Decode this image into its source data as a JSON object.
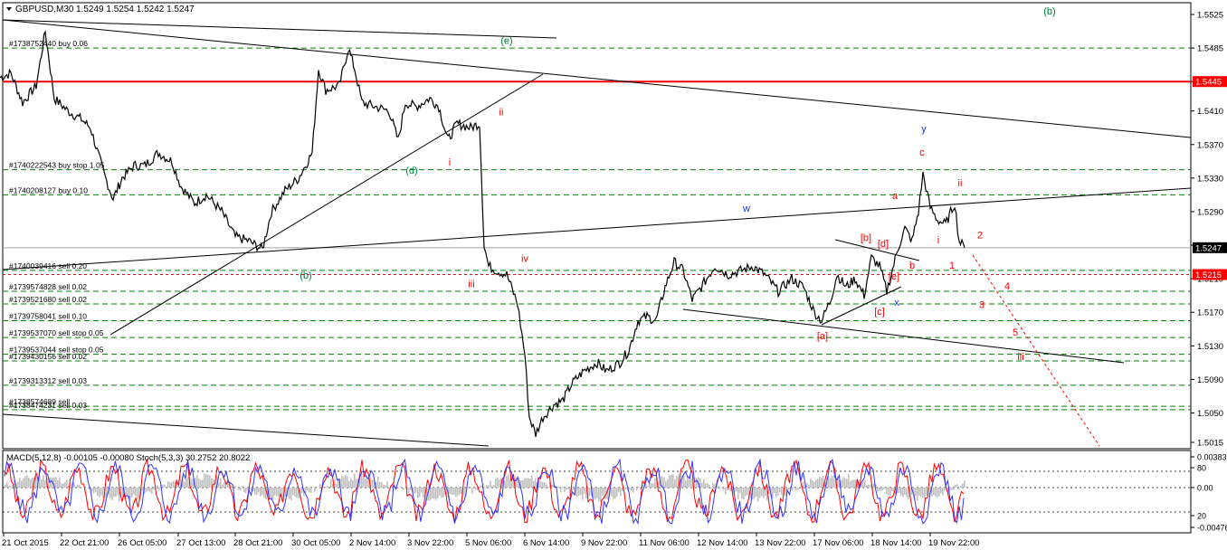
{
  "header": {
    "symbol": "GBPUSD,M30",
    "quote": "1.5249 1.5254 1.5242 1.5247"
  },
  "colors": {
    "price_line": "#000000",
    "resistance": "#ff0000",
    "order_line": "#008000",
    "current_price_bg": "#000000",
    "macd_hist": "#c0c0c0",
    "stoch_main": "#3333ff",
    "stoch_signal": "#ff0000",
    "wave_red": "#ff0000",
    "wave_green": "#008040",
    "wave_blue": "#1a33cc"
  },
  "chart_data": [
    {
      "type": "line",
      "title": "GBPUSD,M30",
      "yaxis_ticks": [
        1.5525,
        1.5485,
        1.5445,
        1.541,
        1.537,
        1.533,
        1.529,
        1.525,
        1.521,
        1.517,
        1.513,
        1.509,
        1.505,
        1.5015
      ],
      "ylim": [
        1.5005,
        1.5535
      ],
      "xaxis_ticks": [
        "21 Oct 2015",
        "22 Oct 21:00",
        "26 Oct 05:00",
        "27 Oct 13:00",
        "28 Oct 21:00",
        "30 Oct 05:00",
        "2 Nov 14:00",
        "3 Nov 22:00",
        "5 Nov 06:00",
        "6 Nov 14:00",
        "9 Nov 22:00",
        "11 Nov 06:00",
        "12 Nov 14:00",
        "13 Nov 22:00",
        "17 Nov 06:00",
        "18 Nov 14:00",
        "19 Nov 22:00"
      ],
      "current_price": "1.5247",
      "price_labels": [
        {
          "text": "1.5445",
          "value": 1.5445,
          "style": "red"
        },
        {
          "text": "1.5247",
          "value": 1.5247,
          "style": "black"
        },
        {
          "text": "1.5215",
          "value": 1.5215,
          "style": "red"
        }
      ],
      "series": [
        {
          "key": "GBPUSD",
          "values": [
            [
              0,
              1.545
            ],
            [
              12,
              1.5455
            ],
            [
              25,
              1.542
            ],
            [
              40,
              1.544
            ],
            [
              50,
              1.5505
            ],
            [
              60,
              1.5425
            ],
            [
              75,
              1.541
            ],
            [
              90,
              1.54
            ],
            [
              100,
              1.539
            ],
            [
              115,
              1.5335
            ],
            [
              125,
              1.5305
            ],
            [
              135,
              1.533
            ],
            [
              148,
              1.5345
            ],
            [
              160,
              1.5345
            ],
            [
              175,
              1.536
            ],
            [
              190,
              1.535
            ],
            [
              200,
              1.532
            ],
            [
              215,
              1.53
            ],
            [
              228,
              1.531
            ],
            [
              245,
              1.529
            ],
            [
              260,
              1.526
            ],
            [
              275,
              1.5255
            ],
            [
              290,
              1.5245
            ],
            [
              300,
              1.529
            ],
            [
              315,
              1.5315
            ],
            [
              330,
              1.533
            ],
            [
              345,
              1.536
            ],
            [
              352,
              1.546
            ],
            [
              360,
              1.5435
            ],
            [
              375,
              1.544
            ],
            [
              385,
              1.5485
            ],
            [
              392,
              1.546
            ],
            [
              400,
              1.542
            ],
            [
              415,
              1.5415
            ],
            [
              430,
              1.541
            ],
            [
              440,
              1.5375
            ],
            [
              448,
              1.542
            ],
            [
              460,
              1.5415
            ],
            [
              475,
              1.5425
            ],
            [
              485,
              1.5415
            ],
            [
              495,
              1.5375
            ],
            [
              505,
              1.5395
            ],
            [
              520,
              1.539
            ],
            [
              530,
              1.5395
            ],
            [
              535,
              1.525
            ],
            [
              540,
              1.5225
            ],
            [
              548,
              1.522
            ],
            [
              560,
              1.5215
            ],
            [
              572,
              1.518
            ],
            [
              580,
              1.512
            ],
            [
              585,
              1.5045
            ],
            [
              592,
              1.5025
            ],
            [
              600,
              1.5045
            ],
            [
              612,
              1.506
            ],
            [
              622,
              1.5065
            ],
            [
              632,
              1.5085
            ],
            [
              645,
              1.51
            ],
            [
              660,
              1.511
            ],
            [
              670,
              1.51
            ],
            [
              685,
              1.511
            ],
            [
              695,
              1.5125
            ],
            [
              705,
              1.516
            ],
            [
              715,
              1.5165
            ],
            [
              725,
              1.516
            ],
            [
              735,
              1.52
            ],
            [
              745,
              1.523
            ],
            [
              755,
              1.522
            ],
            [
              765,
              1.5185
            ],
            [
              775,
              1.52
            ],
            [
              790,
              1.5225
            ],
            [
              805,
              1.5215
            ],
            [
              820,
              1.522
            ],
            [
              832,
              1.5225
            ],
            [
              845,
              1.5215
            ],
            [
              860,
              1.5195
            ],
            [
              875,
              1.521
            ],
            [
              888,
              1.52
            ],
            [
              900,
              1.517
            ],
            [
              908,
              1.516
            ],
            [
              918,
              1.5185
            ],
            [
              925,
              1.5215
            ],
            [
              935,
              1.52
            ],
            [
              945,
              1.521
            ],
            [
              955,
              1.519
            ],
            [
              963,
              1.5235
            ],
            [
              972,
              1.5225
            ],
            [
              980,
              1.5195
            ],
            [
              985,
              1.5215
            ],
            [
              992,
              1.5245
            ],
            [
              1000,
              1.527
            ],
            [
              1008,
              1.5255
            ],
            [
              1015,
              1.529
            ],
            [
              1020,
              1.5335
            ],
            [
              1028,
              1.5295
            ],
            [
              1036,
              1.528
            ],
            [
              1045,
              1.5275
            ],
            [
              1055,
              1.53
            ],
            [
              1060,
              1.5255
            ],
            [
              1066,
              1.5247
            ]
          ]
        }
      ],
      "horizontal_lines": [
        {
          "value": 1.5445,
          "style": "solid",
          "color": "red"
        },
        {
          "value": 1.5215,
          "style": "dashed",
          "color": "red"
        }
      ],
      "order_lines": [
        {
          "text": "#1738752440 buy 0.06",
          "value": 1.5485
        },
        {
          "text": "#1740222543 buy stop 1.05",
          "value": 1.534
        },
        {
          "text": "#1740208127 buy 0.10",
          "value": 1.531
        },
        {
          "text": "#1740039416 sell 0.20",
          "value": 1.522
        },
        {
          "text": "#1739574828 sell 0.02",
          "value": 1.5195
        },
        {
          "text": "#1739521680 sell 0.02",
          "value": 1.518
        },
        {
          "text": "#1739758041 sell 0.10",
          "value": 1.516
        },
        {
          "text": "#1739537070 sell stop 0.05",
          "value": 1.514
        },
        {
          "text": "#1739537044 sell stop 0.05",
          "value": 1.512
        },
        {
          "text": "#1739430156 sell 0.02",
          "value": 1.5112
        },
        {
          "text": "#1739313312 sell 0.03",
          "value": 1.5083
        },
        {
          "text": "#1738574689 sell",
          "value": 1.5058
        },
        {
          "text": "#1738474231 sell 0.03",
          "value": 1.5054
        }
      ],
      "annotations": [
        {
          "text": "(b)",
          "x": 1160,
          "y": 1.5525,
          "color": "green"
        },
        {
          "text": "(e)",
          "x": 560,
          "y": 1.549,
          "color": "green"
        },
        {
          "text": "ii",
          "x": 554,
          "y": 1.5405,
          "color": "red"
        },
        {
          "text": "i",
          "x": 497,
          "y": 1.5345,
          "color": "red"
        },
        {
          "text": "(d)",
          "x": 455,
          "y": 1.5335,
          "color": "green"
        },
        {
          "text": "(b)",
          "x": 338,
          "y": 1.521,
          "color": "green"
        },
        {
          "text": "iii",
          "x": 521,
          "y": 1.52,
          "color": "red"
        },
        {
          "text": "iv",
          "x": 580,
          "y": 1.523,
          "color": "red"
        },
        {
          "text": "w",
          "x": 825,
          "y": 1.529,
          "color": "blue"
        },
        {
          "text": "y",
          "x": 1021,
          "y": 1.5385,
          "color": "blue"
        },
        {
          "text": "c",
          "x": 1019,
          "y": 1.5357,
          "color": "red"
        },
        {
          "text": "ii",
          "x": 1061,
          "y": 1.532,
          "color": "red"
        },
        {
          "text": "a",
          "x": 989,
          "y": 1.5305,
          "color": "red"
        },
        {
          "text": "[b]",
          "x": 957,
          "y": 1.5255,
          "color": "red"
        },
        {
          "text": "[d]",
          "x": 976,
          "y": 1.5248,
          "color": "red"
        },
        {
          "text": "i",
          "x": 1037,
          "y": 1.5252,
          "color": "red"
        },
        {
          "text": "2",
          "x": 1083,
          "y": 1.5258,
          "color": "red"
        },
        {
          "text": "b",
          "x": 1008,
          "y": 1.5222,
          "color": "red"
        },
        {
          "text": "1",
          "x": 1052,
          "y": 1.5222,
          "color": "red"
        },
        {
          "text": "[e]",
          "x": 988,
          "y": 1.5209,
          "color": "red"
        },
        {
          "text": "4",
          "x": 1113,
          "y": 1.5197,
          "color": "red"
        },
        {
          "text": "x",
          "x": 991,
          "y": 1.5178,
          "color": "blue"
        },
        {
          "text": "[c]",
          "x": 972,
          "y": 1.5167,
          "color": "red"
        },
        {
          "text": "3",
          "x": 1085,
          "y": 1.5175,
          "color": "red"
        },
        {
          "text": "[a]",
          "x": 909,
          "y": 1.5138,
          "color": "red"
        },
        {
          "text": "5",
          "x": 1122,
          "y": 1.5142,
          "color": "red"
        },
        {
          "text": "iii",
          "x": 1128,
          "y": 1.5113,
          "color": "red"
        }
      ]
    },
    {
      "type": "line",
      "title": "MACD(5,12,8) -0.00105 -0.00080 Stoch(5,3,3) 30.2752 20.8022",
      "yaxis_ticks": [
        "0.00383",
        "80",
        "0.00",
        "20",
        "-0.00476"
      ],
      "ylim": [
        0,
        100
      ],
      "series": [
        {
          "key": "stoch_main",
          "values": [
            50,
            75,
            30,
            85,
            20,
            90,
            35,
            70,
            15,
            80,
            40,
            95,
            25,
            60,
            10,
            85,
            45,
            90,
            20,
            75
          ]
        },
        {
          "key": "stoch_signal",
          "values": [
            55,
            70,
            40,
            80,
            25,
            85,
            40,
            65,
            20,
            75,
            45,
            90,
            30,
            55,
            15,
            80,
            50,
            85,
            25,
            70
          ]
        }
      ]
    }
  ]
}
